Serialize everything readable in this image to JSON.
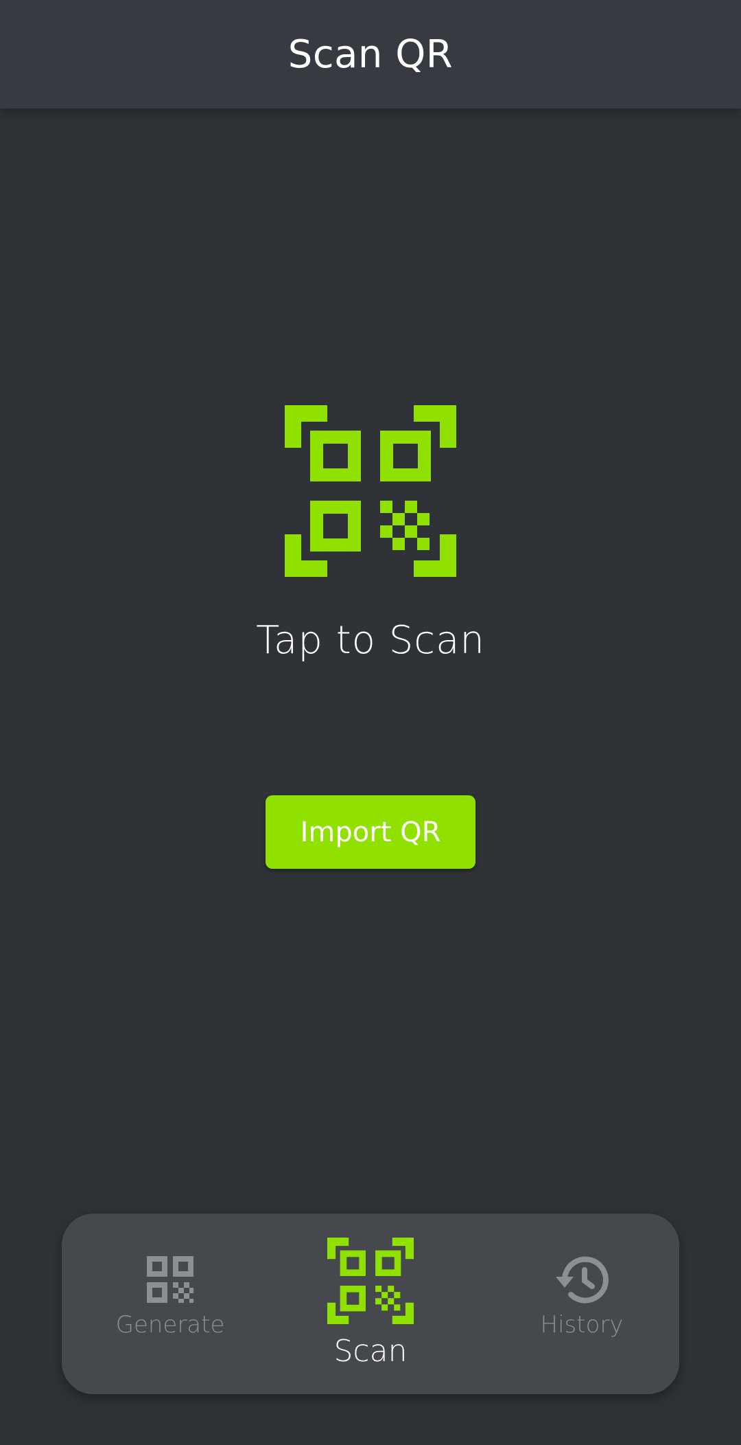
{
  "app_bar": {
    "title": "Scan QR"
  },
  "main": {
    "scan_icon": "qr-scan-icon",
    "scan_prompt": "Tap to Scan",
    "import_button_label": "Import QR"
  },
  "bottom_nav": {
    "items": [
      {
        "id": "generate",
        "label": "Generate",
        "icon": "qr-code-icon",
        "active": false
      },
      {
        "id": "scan",
        "label": "Scan",
        "icon": "qr-scan-icon",
        "active": true
      },
      {
        "id": "history",
        "label": "History",
        "icon": "history-icon",
        "active": false
      }
    ]
  },
  "colors": {
    "background": "#2f3236",
    "app_bar": "#373a40",
    "accent": "#90e000",
    "nav_background": "#45484c",
    "inactive": "#8c8f93",
    "text": "#ffffff"
  }
}
